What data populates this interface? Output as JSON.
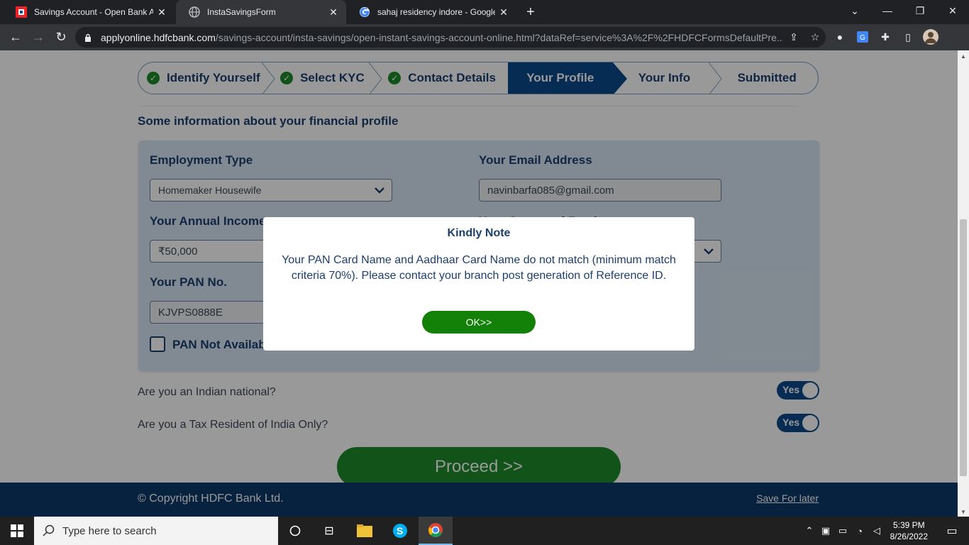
{
  "browser": {
    "tabs": [
      {
        "title": "Savings Account - Open Bank Ac",
        "icon": "hdfc-favicon-icon",
        "close": "✕"
      },
      {
        "title": "InstaSavingsForm",
        "icon": "globe-icon",
        "close": "✕"
      },
      {
        "title": "sahaj residency indore - Google S",
        "icon": "google-icon",
        "close": "✕"
      }
    ],
    "url_domain": "applyonline.hdfcbank.com",
    "url_path": "/savings-account/insta-savings/open-instant-savings-account-online.html?dataRef=service%3A%2F%2FHDFCFormsDefaultPre..."
  },
  "stepper": {
    "steps": [
      {
        "label": "Identify Yourself",
        "state": "done"
      },
      {
        "label": "Select KYC",
        "state": "done"
      },
      {
        "label": "Contact Details",
        "state": "done"
      },
      {
        "label": "Your Profile",
        "state": "active"
      },
      {
        "label": "Your Info",
        "state": "pending"
      },
      {
        "label": "Submitted",
        "state": "pending"
      }
    ]
  },
  "form": {
    "section_title": "Some information about your financial profile",
    "employment_type_label": "Employment Type",
    "employment_type_value": "Homemaker Housewife",
    "email_label": "Your Email Address",
    "email_value": "navinbarfa085@gmail.com",
    "income_label": "Your Annual Income",
    "income_value": "₹50,000",
    "source_of_funds_label": "Your Source of Funds",
    "pan_label": "Your PAN No.",
    "pan_value": "KJVPS0888E",
    "pan_not_available_label": "PAN Not Available"
  },
  "questions": [
    {
      "text": "Are you an Indian national?",
      "toggle": "Yes"
    },
    {
      "text": "Are you a Tax Resident of India Only?",
      "toggle": "Yes"
    }
  ],
  "proceed_label": "Proceed >>",
  "footer": {
    "copyright": "© Copyright HDFC Bank Ltd.",
    "save_later": "Save For later"
  },
  "modal": {
    "title": "Kindly Note",
    "message": "Your PAN Card Name and Aadhaar Card Name do not match (minimum match criteria 70%). Please contact your branch post generation of Reference ID.",
    "ok_label": "OK>>"
  },
  "taskbar": {
    "search_placeholder": "Type here to search",
    "time": "5:39 PM",
    "date": "8/26/2022"
  },
  "colors": {
    "brand_blue": "#0d4a8b",
    "brand_green": "#1f8a2a",
    "footer_blue": "#0d3a6a"
  }
}
